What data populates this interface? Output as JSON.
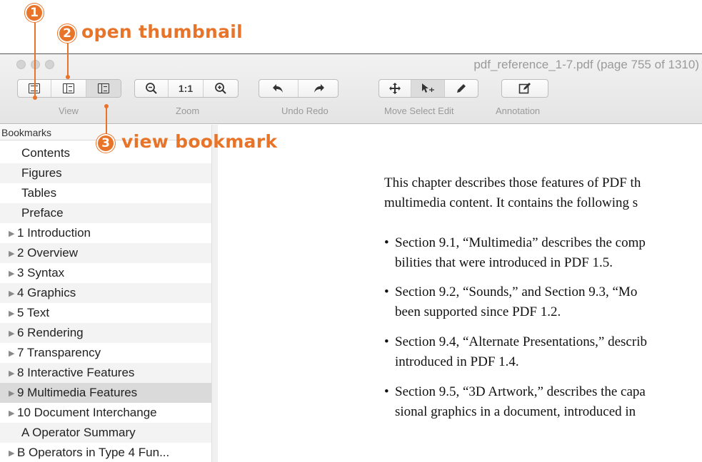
{
  "annotations": {
    "step1": "1",
    "step2": "2",
    "step2_label": "open thumbnail",
    "step3": "3",
    "step3_label": "view bookmark",
    "accent_color": "#e8742a"
  },
  "window": {
    "title": "pdf_reference_1-7.pdf (page 755 of 1310)"
  },
  "toolbar": {
    "groups": {
      "view": "View",
      "zoom": "Zoom",
      "undo_redo": "Undo Redo",
      "move_select_edit": "Move Select Edit",
      "annotation": "Annotation"
    },
    "zoom_actual": "1:1"
  },
  "sidebar": {
    "header": "Bookmarks",
    "items": [
      {
        "label": "Contents"
      },
      {
        "label": "Figures"
      },
      {
        "label": "Tables"
      },
      {
        "label": "Preface"
      },
      {
        "label": "1 Introduction"
      },
      {
        "label": "2 Overview"
      },
      {
        "label": "3 Syntax"
      },
      {
        "label": "4 Graphics"
      },
      {
        "label": "5 Text"
      },
      {
        "label": "6 Rendering"
      },
      {
        "label": "7 Transparency"
      },
      {
        "label": "8 Interactive Features"
      },
      {
        "label": "9 Multimedia Features"
      },
      {
        "label": "10 Document Interchange"
      },
      {
        "label": "A Operator Summary"
      },
      {
        "label": "B Operators in Type 4 Fun..."
      }
    ],
    "selected": "9 Multimedia Features"
  },
  "document": {
    "intro_line1": "This chapter describes those features of PDF th",
    "intro_line2": "multimedia content. It contains the following s",
    "bullets": [
      {
        "line1": "Section 9.1, “Multimedia” describes the comp",
        "line2": "bilities that were introduced in PDF 1.5."
      },
      {
        "line1": "Section 9.2, “Sounds,” and Section 9.3, “Mo",
        "line2": "been supported since PDF 1.2."
      },
      {
        "line1": "Section 9.4, “Alternate Presentations,” describ",
        "line2": "introduced in PDF 1.4."
      },
      {
        "line1": "Section 9.5, “3D Artwork,” describes the capa",
        "line2": "sional graphics in a document, introduced in"
      }
    ]
  }
}
